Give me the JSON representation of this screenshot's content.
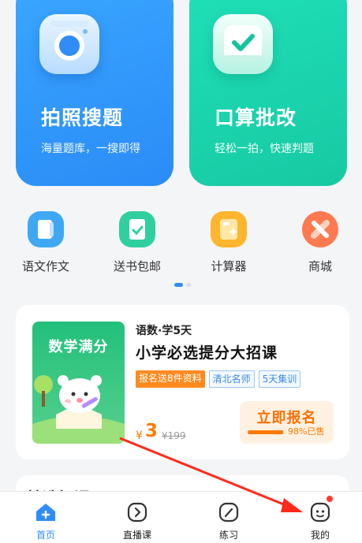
{
  "features": [
    {
      "title": "拍照搜题",
      "subtitle": "海量题库，一搜即得",
      "icon": "camera-icon",
      "color": "#2f8cf8"
    },
    {
      "title": "口算批改",
      "subtitle": "轻松一拍，快速判题",
      "icon": "check-icon",
      "color": "#1bd3ad"
    }
  ],
  "shortcuts": [
    {
      "label": "语文作文",
      "icon": "notebook-icon",
      "color": "#3fa8f5"
    },
    {
      "label": "送书包邮",
      "icon": "book-icon",
      "color": "#2fcfa0"
    },
    {
      "label": "计算器",
      "icon": "calculator-icon",
      "color": "#ffb52e"
    },
    {
      "label": "商城",
      "icon": "store-icon",
      "color": "#ff7a50"
    }
  ],
  "course": {
    "cover_title": "数学满分",
    "category": "语数·学5天",
    "title": "小学必选提分大招课",
    "tags": [
      "报名送8件资料",
      "清北名师",
      "5天集训"
    ],
    "currency": "¥",
    "price": "3",
    "original_price": "¥199",
    "signup_label": "立即报名",
    "sold_percent": 98,
    "sold_text": "98%已售"
  },
  "next_section": {
    "title": "精选好课"
  },
  "tabs": [
    {
      "label": "首页",
      "icon": "home-icon",
      "active": true
    },
    {
      "label": "直播课",
      "icon": "play-circle-icon",
      "active": false
    },
    {
      "label": "练习",
      "icon": "pencil-icon",
      "active": false
    },
    {
      "label": "我的",
      "icon": "profile-face-icon",
      "active": false,
      "has_badge": true
    }
  ],
  "colors": {
    "accent": "#2f8cf8",
    "price": "#ff7a00",
    "badge": "#ff3b30"
  }
}
